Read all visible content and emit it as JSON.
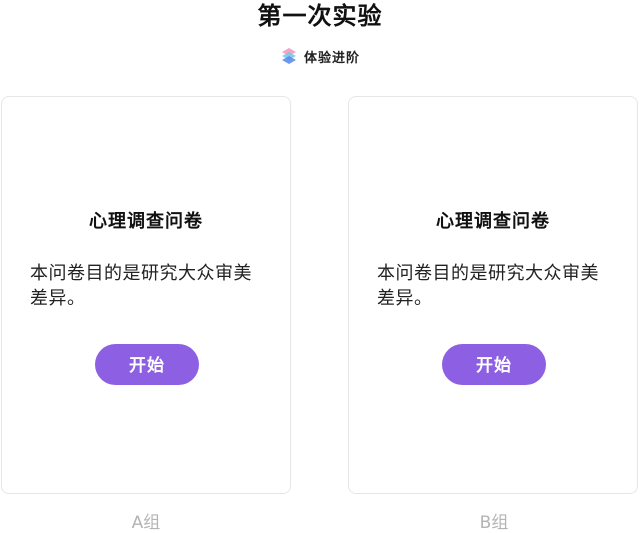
{
  "page": {
    "title": "第一次实验",
    "brand": {
      "name": "体验进阶",
      "icon": "stacked-layers-logo-icon"
    }
  },
  "cards": [
    {
      "heading": "心理调查问卷",
      "description": "本问卷目的是研究大众审美差异。",
      "button_label": "开始",
      "group_label": "A组"
    },
    {
      "heading": "心理调查问卷",
      "description": "本问卷目的是研究大众审美差异。",
      "button_label": "开始",
      "group_label": "B组"
    }
  ],
  "colors": {
    "button_bg": "#8d5fe2",
    "group_label": "#b4b4b4",
    "card_border": "#e6e6e6"
  }
}
